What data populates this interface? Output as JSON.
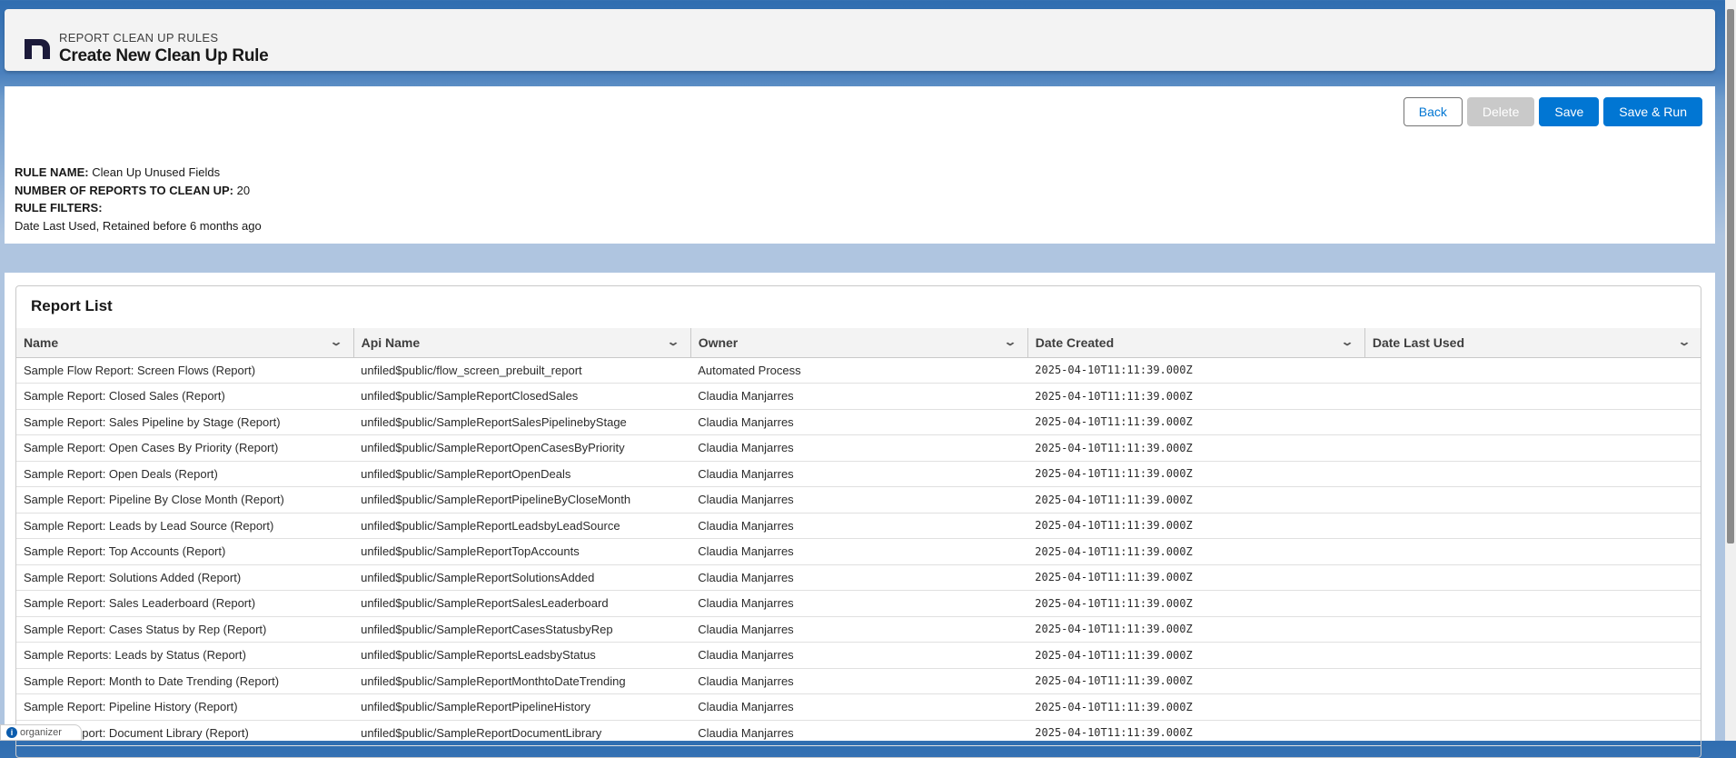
{
  "header": {
    "eyebrow": "REPORT CLEAN UP RULES",
    "title": "Create New Clean Up Rule"
  },
  "actions": {
    "back": "Back",
    "delete": "Delete",
    "save": "Save",
    "save_run": "Save & Run"
  },
  "rule": {
    "name_label": "RULE NAME:",
    "name": "Clean Up Unused Fields",
    "count_label": "NUMBER OF REPORTS TO CLEAN UP:",
    "count": "20",
    "filters_label": "RULE FILTERS:",
    "filters": "Date Last Used, Retained before 6 months ago"
  },
  "report_list": {
    "title": "Report List",
    "columns": [
      "Name",
      "Api Name",
      "Owner",
      "Date Created",
      "Date Last Used"
    ],
    "rows": [
      [
        "Sample Flow Report: Screen Flows (Report)",
        "unfiled$public/flow_screen_prebuilt_report",
        "Automated Process",
        "2025-04-10T11:11:39.000Z",
        ""
      ],
      [
        "Sample Report: Closed Sales (Report)",
        "unfiled$public/SampleReportClosedSales",
        "Claudia Manjarres",
        "2025-04-10T11:11:39.000Z",
        ""
      ],
      [
        "Sample Report: Sales Pipeline by Stage (Report)",
        "unfiled$public/SampleReportSalesPipelinebyStage",
        "Claudia Manjarres",
        "2025-04-10T11:11:39.000Z",
        ""
      ],
      [
        "Sample Report: Open Cases By Priority (Report)",
        "unfiled$public/SampleReportOpenCasesByPriority",
        "Claudia Manjarres",
        "2025-04-10T11:11:39.000Z",
        ""
      ],
      [
        "Sample Report: Open Deals (Report)",
        "unfiled$public/SampleReportOpenDeals",
        "Claudia Manjarres",
        "2025-04-10T11:11:39.000Z",
        ""
      ],
      [
        "Sample Report: Pipeline By Close Month (Report)",
        "unfiled$public/SampleReportPipelineByCloseMonth",
        "Claudia Manjarres",
        "2025-04-10T11:11:39.000Z",
        ""
      ],
      [
        "Sample Report: Leads by Lead Source (Report)",
        "unfiled$public/SampleReportLeadsbyLeadSource",
        "Claudia Manjarres",
        "2025-04-10T11:11:39.000Z",
        ""
      ],
      [
        "Sample Report: Top Accounts (Report)",
        "unfiled$public/SampleReportTopAccounts",
        "Claudia Manjarres",
        "2025-04-10T11:11:39.000Z",
        ""
      ],
      [
        "Sample Report: Solutions Added (Report)",
        "unfiled$public/SampleReportSolutionsAdded",
        "Claudia Manjarres",
        "2025-04-10T11:11:39.000Z",
        ""
      ],
      [
        "Sample Report: Sales Leaderboard (Report)",
        "unfiled$public/SampleReportSalesLeaderboard",
        "Claudia Manjarres",
        "2025-04-10T11:11:39.000Z",
        ""
      ],
      [
        "Sample Report: Cases Status by Rep (Report)",
        "unfiled$public/SampleReportCasesStatusbyRep",
        "Claudia Manjarres",
        "2025-04-10T11:11:39.000Z",
        ""
      ],
      [
        "Sample Reports: Leads by Status (Report)",
        "unfiled$public/SampleReportsLeadsbyStatus",
        "Claudia Manjarres",
        "2025-04-10T11:11:39.000Z",
        ""
      ],
      [
        "Sample Report: Month to Date Trending (Report)",
        "unfiled$public/SampleReportMonthtoDateTrending",
        "Claudia Manjarres",
        "2025-04-10T11:11:39.000Z",
        ""
      ],
      [
        "Sample Report: Pipeline History (Report)",
        "unfiled$public/SampleReportPipelineHistory",
        "Claudia Manjarres",
        "2025-04-10T11:11:39.000Z",
        ""
      ],
      [
        "Sample Report: Document Library (Report)",
        "unfiled$public/SampleReportDocumentLibrary",
        "Claudia Manjarres",
        "2025-04-10T11:11:39.000Z",
        ""
      ]
    ]
  },
  "widget": {
    "label": "organizer"
  },
  "colors": {
    "brand": "#0176d3",
    "logo": "#1c1a3a"
  }
}
